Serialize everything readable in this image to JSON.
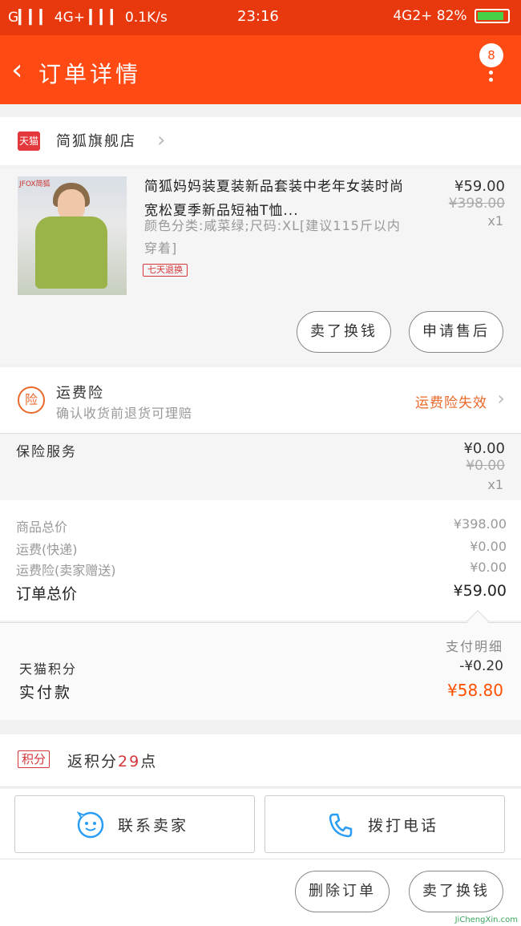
{
  "status_bar": {
    "left": "G▎▎▎ 4G+ ▎▎▎ 0.1K/s",
    "time": "23:16",
    "network": "4G2+",
    "battery": "82%"
  },
  "header": {
    "back_icon": "‹",
    "title": "订单详情",
    "badge": "8"
  },
  "shop": {
    "logo": "天猫",
    "name": "简狐旗舰店"
  },
  "product": {
    "title": "简狐妈妈装夏装新品套装中老年女装时尚宽松夏季新品短袖T恤...",
    "spec": "颜色分类:咸菜绿;尺码:XL[建议115斤以内穿着]",
    "badge": "七天退换",
    "price": "¥59.00",
    "original_price": "¥398.00",
    "quantity": "x1",
    "thumb_brand": "JFOX简狐"
  },
  "actions": {
    "sell_exchange": "卖了换钱",
    "after_sale": "申请售后"
  },
  "shipping_insurance": {
    "icon": "险",
    "title": "运费险",
    "subtitle": "确认收货前退货可理赔",
    "status": "运费险失效"
  },
  "insurance_service": {
    "label": "保险服务",
    "price": "¥0.00",
    "original_price": "¥0.00",
    "quantity": "x1"
  },
  "summary": {
    "goods_total_label": "商品总价",
    "goods_total": "¥398.00",
    "shipping_label": "运费(快递)",
    "shipping": "¥0.00",
    "insurance_label": "运费险(卖家赠送)",
    "insurance": "¥0.00",
    "order_total_label": "订单总价",
    "order_total": "¥59.00"
  },
  "payment": {
    "detail_link": "支付明细",
    "points_label": "天猫积分",
    "points_value": "-¥0.20",
    "actual_label": "实付款",
    "actual_value": "¥58.80"
  },
  "points": {
    "tag": "积分",
    "text_before": "返积分",
    "count": "29",
    "text_after": "点"
  },
  "contact": {
    "seller": "联系卖家",
    "call": "拨打电话"
  },
  "bottom": {
    "delete": "删除订单",
    "sell_exchange": "卖了换钱",
    "watermark": "JiChengXin.com"
  },
  "colors": {
    "header": "#ff4a14",
    "accent_orange": "#e9692b",
    "price_orange": "#ff5000",
    "tmall_red": "#d4363a"
  }
}
